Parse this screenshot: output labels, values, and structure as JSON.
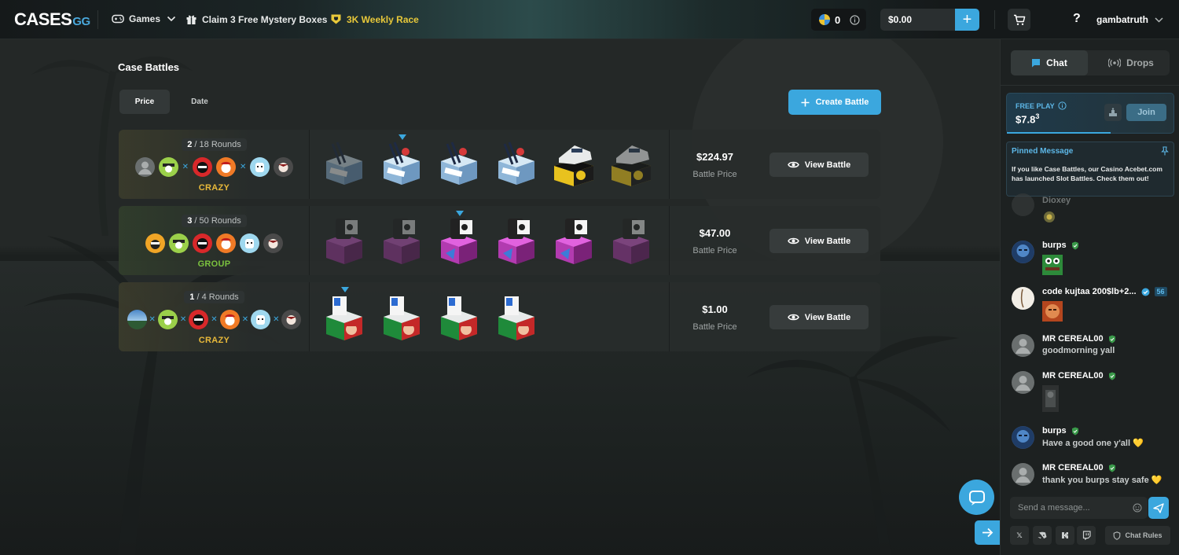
{
  "header": {
    "logo_main": "CASES",
    "logo_suffix": "GG",
    "nav_games": "Games",
    "nav_mystery": "Claim 3 Free Mystery Boxes",
    "nav_race": "3K Weekly Race",
    "coins": "0",
    "balance": "$0.00",
    "deposit_label": "+",
    "help_label": "?",
    "username": "gambatruth"
  },
  "page": {
    "title": "Case Battles",
    "sort_tabs": [
      "Price",
      "Date"
    ],
    "create_label": "Create Battle"
  },
  "battles": [
    {
      "current_round": "2",
      "total_rounds": "/ 18 Rounds",
      "mode": "CRAZY",
      "price": "$224.97",
      "price_label": "Battle Price",
      "view_label": "View Battle"
    },
    {
      "current_round": "3",
      "total_rounds": "/ 50 Rounds",
      "mode": "GROUP",
      "price": "$47.00",
      "price_label": "Battle Price",
      "view_label": "View Battle"
    },
    {
      "current_round": "1",
      "total_rounds": "/ 4 Rounds",
      "mode": "CRAZY",
      "price": "$1.00",
      "price_label": "Battle Price",
      "view_label": "View Battle"
    }
  ],
  "chat": {
    "tab_chat": "Chat",
    "tab_drops": "Drops",
    "freeplay_label": "FREE PLAY",
    "freeplay_amount": "$7.8",
    "freeplay_sup": "3",
    "join_label": "Join",
    "pinned_title": "Pinned Message",
    "pinned_text": "If you like Case Battles, our Casino Acebet.com has launched Slot Battles. Check them out!",
    "partial_name": "Dioxey",
    "messages": [
      {
        "name": "burps",
        "text": ""
      },
      {
        "name": "code kujtaa 200$lb+2...",
        "text": "",
        "level": "56"
      },
      {
        "name": "MR CEREAL00",
        "text": "goodmorning yall"
      },
      {
        "name": "MR CEREAL00",
        "text": ""
      },
      {
        "name": "burps",
        "text": "Have a good one y'all 💛"
      },
      {
        "name": "MR CEREAL00",
        "text": "thank you burps stay safe 💛"
      }
    ],
    "input_placeholder": "Send a message...",
    "rules_label": "Chat Rules"
  },
  "colors": {
    "accent": "#3ba7de",
    "crazy": "#e8b93a",
    "group": "#7bc23e",
    "race": "#e8c83a"
  }
}
